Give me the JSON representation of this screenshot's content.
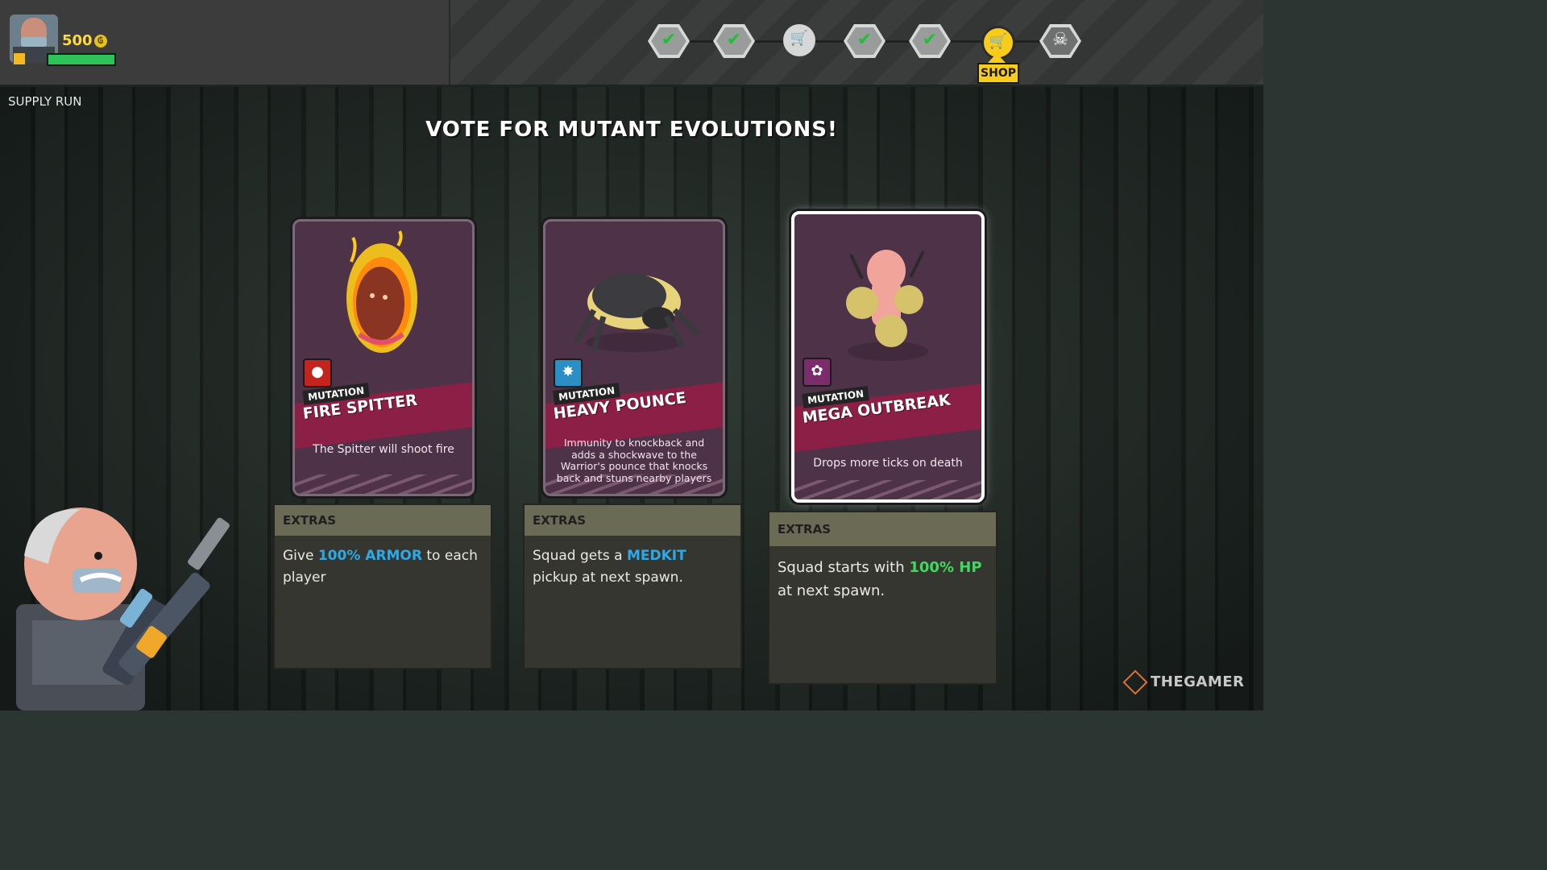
{
  "hud": {
    "coins": "500",
    "coin_symbol": "₲",
    "hp_fraction": 1.0,
    "location": "SUPPLY RUN",
    "shop_label": "SHOP"
  },
  "progress": {
    "nodes": [
      {
        "name": "completed-node-1",
        "icon": "check-icon",
        "state": "completed"
      },
      {
        "name": "completed-node-2",
        "icon": "check-icon",
        "state": "completed"
      },
      {
        "name": "shop-node-1",
        "icon": "cart-icon",
        "state": "upcoming"
      },
      {
        "name": "completed-node-3",
        "icon": "check-icon",
        "state": "completed"
      },
      {
        "name": "completed-node-4",
        "icon": "check-icon",
        "state": "completed"
      },
      {
        "name": "shop-node-current",
        "icon": "cart-icon",
        "state": "current"
      },
      {
        "name": "boss-node",
        "icon": "skull-icon",
        "state": "upcoming"
      }
    ]
  },
  "heading": "VOTE FOR MUTANT EVOLUTIONS!",
  "cards": [
    {
      "type_label": "MUTATION",
      "title": "FIRE SPITTER",
      "description": "The Spitter will shoot fire",
      "badge_color": "#c4241d",
      "extras_header": "EXTRAS",
      "extras_pre": "Give ",
      "extras_highlight": "100% ARMOR",
      "extras_post": " to each player",
      "highlight_color": "#2ea9e8",
      "selected": false
    },
    {
      "type_label": "MUTATION",
      "title": "HEAVY POUNCE",
      "description": "Immunity to knockback and adds a shockwave to the Warrior's pounce that knocks back and stuns nearby players",
      "badge_color": "#2a8fc4",
      "extras_header": "EXTRAS",
      "extras_pre": "Squad gets a ",
      "extras_highlight": "MEDKIT",
      "extras_post": " pickup at next spawn.",
      "highlight_color": "#2ea9e8",
      "selected": false
    },
    {
      "type_label": "MUTATION",
      "title": "MEGA OUTBREAK",
      "description": "Drops more ticks on death",
      "badge_color": "#7b2c6a",
      "extras_header": "EXTRAS",
      "extras_pre": "Squad starts with ",
      "extras_highlight": "100% HP",
      "extras_post": " at next spawn.",
      "highlight_color": "#3fd95e",
      "selected": true
    }
  ],
  "watermark": "THEGAMER"
}
